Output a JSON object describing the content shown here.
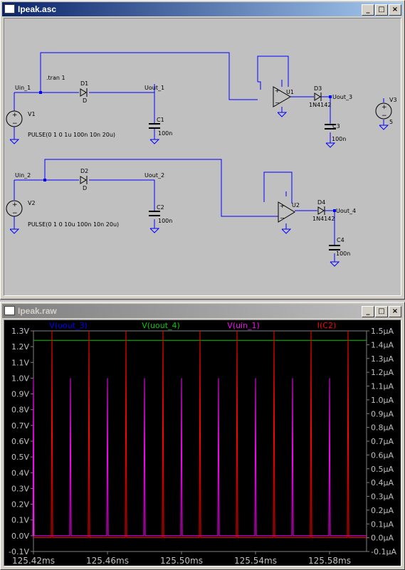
{
  "schematic": {
    "title": "Ipeak.asc",
    "labels": {
      "uin1": "Uin_1",
      "uout1": "Uout_1",
      "uin2": "Uin_2",
      "uout2": "Uout_2",
      "uout3": "Uout_3",
      "uout4": "Uout_4",
      "tran": ".tran 1",
      "d1": "D1",
      "d2": "D2",
      "d3": "D3",
      "d4": "D4",
      "d1model": "D",
      "d2model": "D",
      "d3model": "1N4142",
      "d4model": "1N4142",
      "v1": "V1",
      "v2": "V2",
      "v3": "V3",
      "c1": "C1",
      "c2": "C2",
      "c3": "C3",
      "c4": "C4",
      "c1val": "100n",
      "c2val": "100n",
      "c3val": "100n",
      "c4val": "100n",
      "u1": "U1",
      "u2": "U2",
      "v3val": "5",
      "pulse1": "PULSE(0 1 0 1u 100n 10n 20u)",
      "pulse2": "PULSE(0 1 0 10u 100n 10n 20u)"
    }
  },
  "waveform": {
    "title": "Ipeak.raw",
    "traces": [
      {
        "name": "V(uout_3)",
        "color": "#0000ff"
      },
      {
        "name": "V(uout_4)",
        "color": "#00cc00"
      },
      {
        "name": "V(uin_1)",
        "color": "#ff00ff"
      },
      {
        "name": "I(C2)",
        "color": "#ff0000"
      }
    ],
    "left_ticks": [
      "1.3V",
      "1.2V",
      "1.1V",
      "1.0V",
      "0.9V",
      "0.8V",
      "0.7V",
      "0.6V",
      "0.5V",
      "0.4V",
      "0.3V",
      "0.2V",
      "0.1V",
      "0.0V",
      "-0.1V"
    ],
    "right_ticks": [
      "1.5µA",
      "1.4µA",
      "1.3µA",
      "1.2µA",
      "1.1µA",
      "1.0µA",
      "0.9µA",
      "0.8µA",
      "0.7µA",
      "0.6µA",
      "0.5µA",
      "0.4µA",
      "0.3µA",
      "0.2µA",
      "0.1µA",
      "0.0µA",
      "-0.1µA"
    ],
    "x_ticks": [
      "125.42ms",
      "125.46ms",
      "125.50ms",
      "125.54ms",
      "125.58ms"
    ]
  },
  "chart_data": {
    "type": "line",
    "x_unit": "ms",
    "xlim": [
      125.42,
      125.6
    ],
    "ylim_left": [
      -0.1,
      1.3
    ],
    "ylim_right": [
      -0.1,
      1.5
    ],
    "series": [
      {
        "name": "V(uout_4)",
        "axis": "left",
        "values": [
          [
            125.42,
            1.24
          ],
          [
            125.6,
            1.24
          ]
        ]
      },
      {
        "name": "V(uin_1)",
        "axis": "left",
        "pulse_times": [
          125.42,
          125.44,
          125.46,
          125.48,
          125.5,
          125.52,
          125.54,
          125.56,
          125.58
        ],
        "peak": 1.0
      },
      {
        "name": "I(C2)",
        "axis": "right",
        "pulse_times": [
          125.43,
          125.45,
          125.47,
          125.49,
          125.51,
          125.53,
          125.55,
          125.57,
          125.59
        ],
        "peak": 1.5
      }
    ]
  }
}
